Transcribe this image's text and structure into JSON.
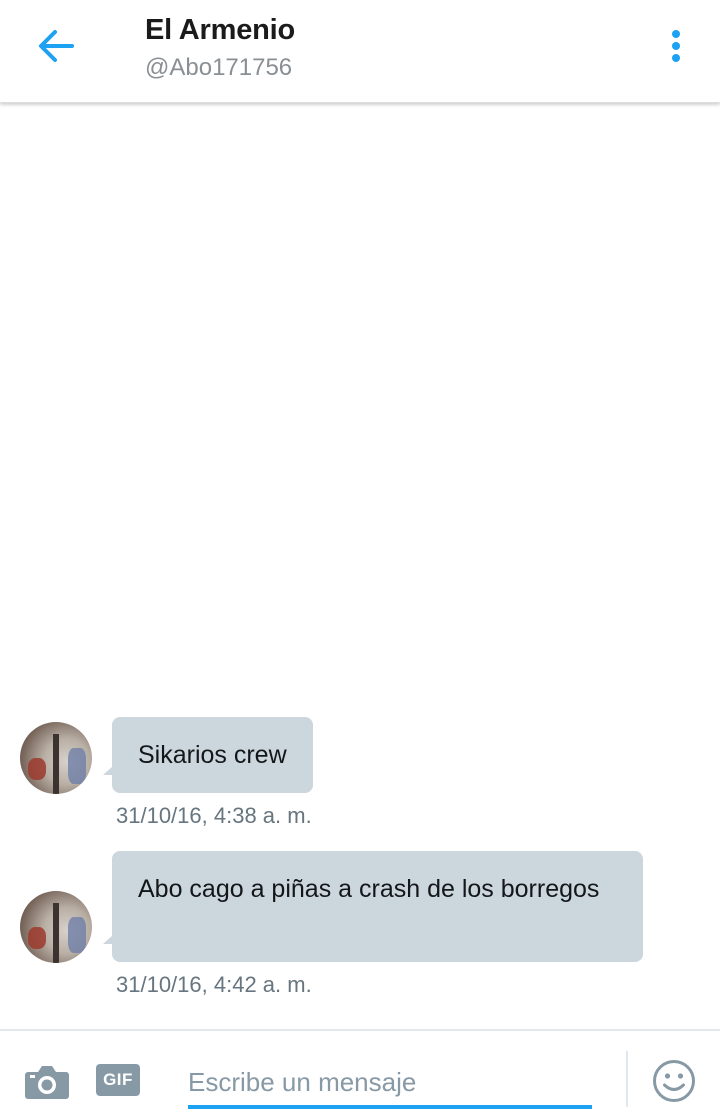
{
  "header": {
    "title": "El Armenio",
    "handle": "@Abo171756",
    "back_icon": "arrow-left-icon",
    "menu_icon": "more-vertical-icon"
  },
  "messages": [
    {
      "text": "Sikarios crew",
      "timestamp": "31/10/16, 4:38 a. m."
    },
    {
      "text": "Abo cago a piñas a crash de los borregos",
      "timestamp": "31/10/16, 4:42 a. m."
    }
  ],
  "composer": {
    "camera_icon": "camera-icon",
    "gif_label": "GIF",
    "placeholder": "Escribe un mensaje",
    "value": "",
    "emoji_icon": "smiley-icon"
  },
  "colors": {
    "accent": "#1da1f2",
    "bubble": "#ccd6dd",
    "secondary_text": "#66757f",
    "icon_gray": "#8899a6"
  }
}
